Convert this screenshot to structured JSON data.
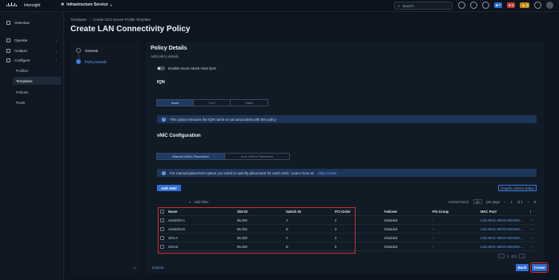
{
  "topbar": {
    "brand": "Intersight",
    "service": "Infrastructure Service",
    "search_placeholder": "Search",
    "badges": {
      "alerts_blue": "7",
      "alerts_red": "3",
      "alerts_amber": "6"
    }
  },
  "sidebar": {
    "items": [
      {
        "label": "Overview"
      },
      {
        "label": "Operate"
      },
      {
        "label": "Analyze"
      },
      {
        "label": "Configure"
      }
    ],
    "sub_items": [
      "Profiles",
      "Templates",
      "Policies",
      "Pools"
    ]
  },
  "header": {
    "breadcrumb": [
      "Templates",
      "Create UCS Server Profile Template"
    ],
    "title": "Create LAN Connectivity Policy"
  },
  "steps": [
    {
      "label": "General"
    },
    {
      "label": "Policy Details"
    }
  ],
  "main": {
    "section_title": "Policy Details",
    "section_sub": "Add policy details",
    "toggle_label": "Enable Azure Stack Host QoS",
    "iqn_title": "IQN",
    "iqn_options": [
      "None",
      "Pool",
      "Static"
    ],
    "iqn_info": "This option ensures the IQN name is not associated with the policy",
    "vnic_title": "vNIC Configuration",
    "placement_options": [
      "Manual vNICs Placement",
      "Auto vNICs Placement"
    ],
    "placement_info": "For manual placement option you need to specify placement for each vNIC. Learn more at",
    "placement_info_link": "Help Center",
    "add_vnic": "Add vNIC",
    "graphic_editor": "Graphic vNICs Editor"
  },
  "table": {
    "filter_placeholder": "Add Filter",
    "items_found": "4 items found",
    "per_page_value": "10",
    "per_page_label": "per page",
    "page_current": "1",
    "page_of": "of 1",
    "columns": [
      "Name",
      "Slot ID",
      "Switch ID",
      "PCI Order",
      "Failover",
      "Pin Group",
      "MAC Pool"
    ],
    "rows": [
      {
        "name": "vSwitch0-A",
        "slot": "MLOM",
        "switch": "A",
        "pci": "2",
        "failover": "Disabled",
        "pin": "-",
        "mac": "LIS1-MAC-SEVO-K8-MAC..."
      },
      {
        "name": "vSwitch0-B",
        "slot": "MLOM",
        "switch": "B",
        "pci": "3",
        "failover": "Disabled",
        "pin": "-",
        "mac": "LIS1-MAC-SEVO-K8-MAC..."
      },
      {
        "name": "vDS-A",
        "slot": "MLOM",
        "switch": "A",
        "pci": "4",
        "failover": "Disabled",
        "pin": "-",
        "mac": "LIS1-MAC-SEVO-K8-MAC..."
      },
      {
        "name": "vDS-B",
        "slot": "MLOM",
        "switch": "B",
        "pci": "5",
        "failover": "Disabled",
        "pin": "-",
        "mac": "LIS1-MAC-SEVO-K8-MAC..."
      }
    ]
  },
  "footer": {
    "cancel": "Cancel",
    "back": "Back",
    "create": "Create"
  },
  "colors": {
    "accent": "#2f6fd6",
    "highlight": "#d22a2a",
    "background": "#0d1520"
  }
}
